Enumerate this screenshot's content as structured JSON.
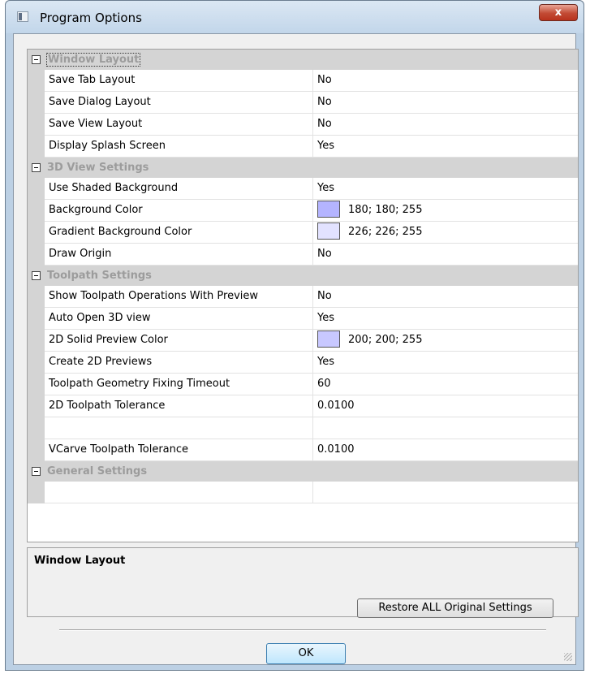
{
  "window": {
    "title": "Program Options",
    "close_glyph": "x"
  },
  "grid": {
    "categories": [
      {
        "label": "Window Layout",
        "rows": [
          {
            "name": "Save Tab Layout",
            "value": "No"
          },
          {
            "name": "Save Dialog Layout",
            "value": "No"
          },
          {
            "name": "Save View Layout",
            "value": "No"
          },
          {
            "name": "Display Splash Screen",
            "value": "Yes"
          }
        ]
      },
      {
        "label": "3D View Settings",
        "rows": [
          {
            "name": "Use Shaded Background",
            "value": "Yes"
          },
          {
            "name": "Background Color",
            "value": "180; 180; 255",
            "swatch": "#b4b4ff"
          },
          {
            "name": "Gradient Background Color",
            "value": "226; 226; 255",
            "swatch": "#e2e2ff"
          },
          {
            "name": "Draw Origin",
            "value": "No"
          }
        ]
      },
      {
        "label": "Toolpath Settings",
        "rows": [
          {
            "name": "Show Toolpath Operations With Preview",
            "value": "No"
          },
          {
            "name": "Auto Open 3D view",
            "value": "Yes"
          },
          {
            "name": "2D Solid Preview Color",
            "value": "200; 200; 255",
            "swatch": "#c8c8ff"
          },
          {
            "name": "Create 2D Previews",
            "value": "Yes"
          },
          {
            "name": "Toolpath Geometry Fixing Timeout",
            "value": "60"
          },
          {
            "name": "2D Toolpath Tolerance",
            "value": "0.0100"
          },
          {
            "name": "",
            "value": ""
          },
          {
            "name": "VCarve Toolpath Tolerance",
            "value": "0.0100"
          }
        ]
      },
      {
        "label": "General Settings",
        "rows": [
          {
            "name": "",
            "value": ""
          }
        ]
      }
    ]
  },
  "description": {
    "title": "Window Layout"
  },
  "buttons": {
    "restore_label": "Restore ALL Original Settings",
    "ok_label": "OK"
  }
}
